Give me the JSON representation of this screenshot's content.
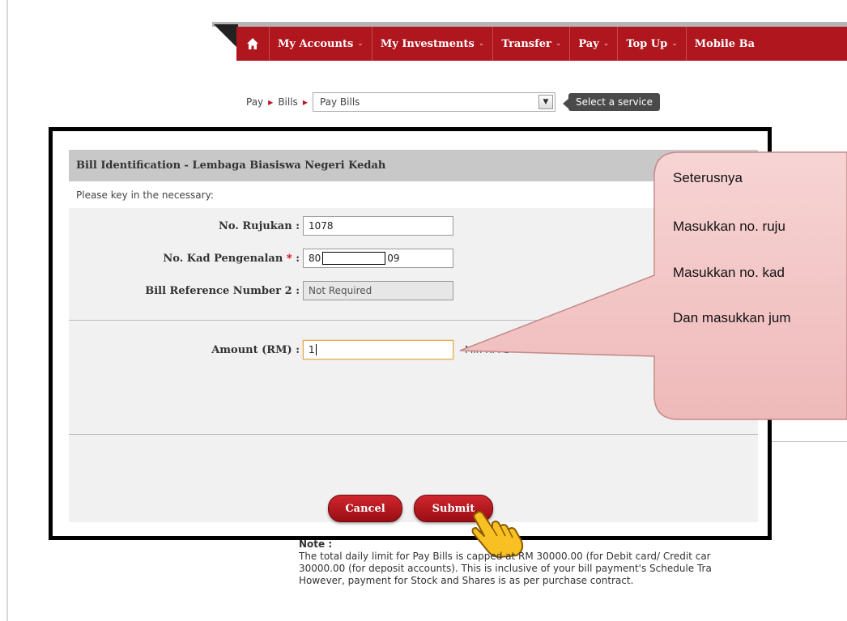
{
  "nav": {
    "items": [
      {
        "label": "My Accounts"
      },
      {
        "label": "My Investments"
      },
      {
        "label": "Transfer"
      },
      {
        "label": "Pay"
      },
      {
        "label": "Top Up"
      },
      {
        "label": "Mobile Ba"
      }
    ]
  },
  "breadcrumb": {
    "items": [
      "Pay",
      "Bills"
    ],
    "select_value": "Pay Bills",
    "service_tip": "Select a service"
  },
  "form": {
    "title": "Bill Identification - Lembaga Biasiswa Negeri Kedah",
    "subtitle": "Please key in the necessary:",
    "ref_label": "No. Rujukan",
    "ref_value": "1078",
    "ic_label": "No. Kad Pengenalan",
    "ic_required": "*",
    "ic_prefix": "80",
    "ic_suffix": "09",
    "billref2_label": "Bill Reference Number 2",
    "billref2_value": "Not Required",
    "amount_label": "Amount (RM)",
    "amount_value": "1",
    "amount_hint": "Min RM 1",
    "colon": ":",
    "cancel_label": "Cancel",
    "submit_label": "Submit"
  },
  "callout": {
    "lines": [
      "Seterusnya",
      "Masukkan no. ruju",
      "Masukkan no. kad",
      "Dan masukkan jum"
    ],
    "fill": "#f4c9c9",
    "stroke": "#c89090"
  },
  "note": {
    "title": "Note :",
    "lines": [
      "The total daily limit for Pay Bills is capped at RM 30000.00 (for Debit card/ Credit car",
      "30000.00 (for deposit accounts). This is inclusive of your bill payment's Schedule Tra",
      "However, payment for Stock and Shares is as per purchase contract."
    ]
  },
  "colors": {
    "nav_red": "#b0161e",
    "button_red": "#b8141c",
    "required": "#d0021b"
  }
}
